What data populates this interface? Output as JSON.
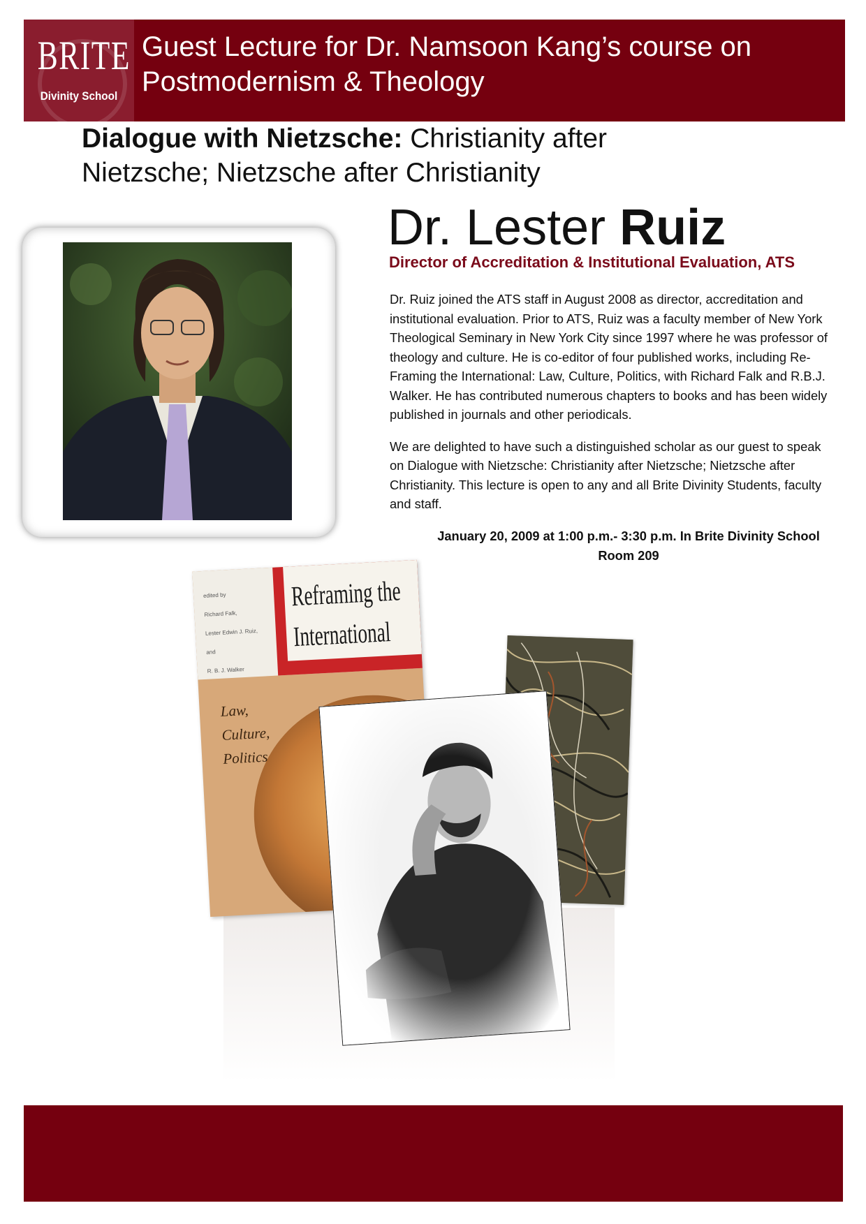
{
  "header": {
    "logo_top": "BRITE",
    "logo_bottom": "Divinity School",
    "title_line1": "Guest Lecture for Dr. Namsoon Kang’s course on",
    "title_line2": "Postmodernism & Theology"
  },
  "lecture": {
    "title_bold": "Dialogue with Nietzsche:",
    "title_rest_line1": " Christianity after",
    "title_line2": "Nietzsche; Nietzsche after Christianity"
  },
  "speaker": {
    "name_prefix": "Dr. Lester ",
    "name_bold": "Ruiz",
    "role": "Director of Accreditation & Institutional Evaluation, ATS"
  },
  "bio": {
    "paragraph1": "Dr. Ruiz joined the ATS staff in August 2008 as director, accreditation and institutional evaluation.  Prior to ATS, Ruiz was a faculty member of New York Theological Seminary in New York City since 1997 where he was professor of theology and culture. He is co-editor of four published works, including Re-Framing the International: Law, Culture, Politics, with Richard Falk and R.B.J. Walker. He has contributed numerous chapters to books and has been widely published in journals and other periodicals.",
    "paragraph2": "We are delighted to have such a distinguished scholar as our guest to speak on Dialogue with Nietzsche: Christianity after Nietzsche; Nietzsche after Christianity. This lecture is open to any and all Brite Divinity Students, faculty and staff."
  },
  "event": {
    "line1": "January 20, 2009 at 1:00 p.m.- 3:30 p.m. In Brite Divinity School",
    "line2": "Room 209"
  },
  "book": {
    "title_line1": "Reframing the",
    "title_line2": "International",
    "editors_line1": "edited by",
    "editors_line2": "Richard Falk,",
    "editors_line3": "Lester Edwin J. Ruiz,",
    "editors_line4": "and",
    "editors_line5": "R. B. J. Walker",
    "subtitle_line1": "Law,",
    "subtitle_line2": "Culture,",
    "subtitle_line3": "Politics"
  },
  "colors": {
    "brand_maroon": "#75000f",
    "role_text": "#7a0a1a"
  }
}
